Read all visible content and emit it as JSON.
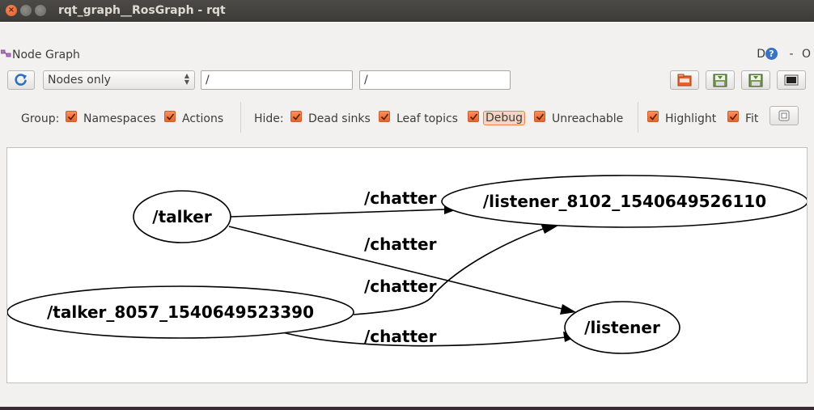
{
  "window": {
    "title": "rqt_graph__RosGraph - rqt",
    "close_glyph": "×",
    "min_glyph": "–",
    "max_glyph": "□"
  },
  "dock": {
    "label": "Node Graph",
    "d_label": "D",
    "help_glyph": "?",
    "minimize_glyph": "-",
    "close_glyph": "O"
  },
  "toolbar": {
    "refresh_icon": "refresh-icon",
    "mode_value": "Nodes only",
    "node_filter_value": "/",
    "topic_filter_value": "/"
  },
  "options": {
    "group_label": "Group:",
    "namespaces_label": "Namespaces",
    "actions_label": "Actions",
    "hide_label": "Hide:",
    "dead_sinks_label": "Dead sinks",
    "leaf_topics_label": "Leaf topics",
    "debug_label": "Debug",
    "unreachable_label": "Unreachable",
    "highlight_label": "Highlight",
    "fit_label": "Fit",
    "namespaces_checked": true,
    "actions_checked": true,
    "dead_sinks_checked": true,
    "leaf_topics_checked": true,
    "debug_checked": true,
    "unreachable_checked": true,
    "highlight_checked": true,
    "fit_checked": true
  },
  "graph": {
    "nodes": {
      "talker": "/talker",
      "listener_long": "/listener_8102_1540649526110",
      "talker_long": "/talker_8057_1540649523390",
      "listener": "/listener"
    },
    "edges": {
      "e1": "/chatter",
      "e2": "/chatter",
      "e3": "/chatter",
      "e4": "/chatter"
    }
  },
  "colors": {
    "accent_checkbox": "#e8632b",
    "titlebar": "#3c3b37",
    "window_bg": "#f2f1f0"
  }
}
